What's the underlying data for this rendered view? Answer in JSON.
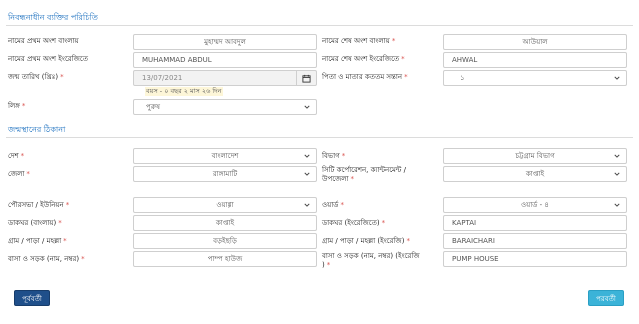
{
  "sections": {
    "person_info_title": "নিবন্ধনাধীন ব্যক্তির পরিচিতি",
    "birthplace_address_title": "জন্মস্থানের ঠিকানা"
  },
  "person": {
    "first_name_bn": {
      "label": "নামের প্রথম অংশ বাংলায়",
      "value": "মুহাম্মদ আবদুল"
    },
    "last_name_bn": {
      "label": "নামের শেষ অংশ বাংলায়",
      "required": "*",
      "value": "আউয়াল"
    },
    "first_name_en": {
      "label": "নামের প্রথম অংশ ইংরেজিতে",
      "value": "MUHAMMAD ABDUL"
    },
    "last_name_en": {
      "label": "নামের শেষ অংশ ইংরেজিতে",
      "required": "*",
      "value": "AHWAL"
    },
    "dob": {
      "label": "জন্ম তারিখ (খ্রিঃ)",
      "required": "*",
      "value": "13/07/2021",
      "age_hint": "বয়স - ০ বছর ২ মাস ২৬ দিন"
    },
    "birth_order": {
      "label": "পিতা ও মাতার কততম সন্তান",
      "required": "*",
      "value": "১"
    },
    "gender": {
      "label": "লিঙ্গ",
      "required": "*",
      "value": "পুরুষ"
    }
  },
  "address": {
    "country": {
      "label": "দেশ",
      "required": "*",
      "value": "বাংলাদেশ"
    },
    "division": {
      "label": "বিভাগ",
      "required": "*",
      "value": "চট্টগ্রাম বিভাগ"
    },
    "district": {
      "label": "জেলা",
      "required": "*",
      "value": "রাঙ্গামাটি"
    },
    "upazila": {
      "label_line1": "সিটি কর্পোরেশন, ক্যান্টনমেন্ট /",
      "label_line2": "উপজেলা",
      "required": "*",
      "value": "কাপ্তাই"
    },
    "union": {
      "label": "পৌরসভা / ইউনিয়ন",
      "required": "*",
      "value": "ওয়াগ্গা"
    },
    "ward": {
      "label": "ওয়ার্ড",
      "required": "*",
      "value": "ওয়ার্ড - ৪"
    },
    "post_office_bn": {
      "label": "ডাকঘর (বাংলায়)",
      "required": "*",
      "value": "কাপ্তাই"
    },
    "post_office_en": {
      "label": "ডাকঘর (ইংরেজিতে)",
      "required": "*",
      "value": "KAPTAI"
    },
    "village_bn": {
      "label": "গ্রাম / পাড়া / মহল্লা",
      "required": "*",
      "value": "বড়ইছড়ি"
    },
    "village_en": {
      "label": "গ্রাম / পাড়া / মহল্লা (ইংরেজি)",
      "required": "*",
      "value": "BARAICHARI"
    },
    "road_bn": {
      "label": "বাসা ও সড়ক (নাম, নম্বর)",
      "required": "*",
      "value": "পাম্প হাউজ"
    },
    "road_en": {
      "label_line1": "বাসা ও সড়ক (নাম, নম্বর) (ইংরেজি",
      "label_line2": ")",
      "required": "*",
      "value": "PUMP HOUSE"
    }
  },
  "buttons": {
    "previous": "পূর্ববর্তী",
    "next": "পরবর্তী"
  },
  "icons": {
    "calendar": "calendar-icon",
    "chevron": "chevron-down-icon"
  },
  "colors": {
    "section_title": "#1a6fbf",
    "required_mark": "#d9534f",
    "prev_button": "#1f4f8a",
    "next_button": "#3bb3d8",
    "age_hint_bg": "#fdf6d8"
  }
}
